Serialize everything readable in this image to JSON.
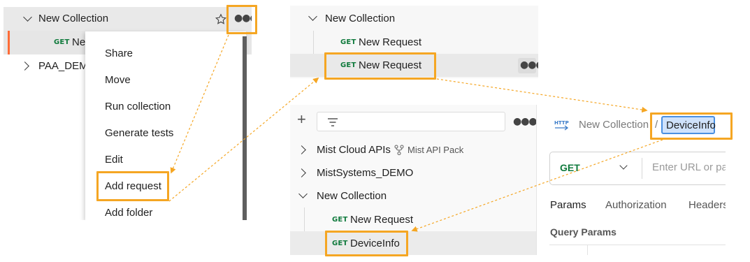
{
  "panelA": {
    "collection": "New Collection",
    "request_method": "GET",
    "request_name_truncated": "Ne",
    "second_collection": "PAA_DEM",
    "menu_items": [
      "Share",
      "Move",
      "Run collection",
      "Generate tests",
      "Edit",
      "Add request",
      "Add folder"
    ]
  },
  "panelB": {
    "collection": "New Collection",
    "requests": [
      {
        "method": "GET",
        "name": "New Request"
      },
      {
        "method": "GET",
        "name": "New Request"
      }
    ]
  },
  "panelC": {
    "collections": [
      {
        "name": "Mist Cloud APIs",
        "fork_label": "Mist API Pack"
      },
      {
        "name": "MistSystems_DEMO"
      },
      {
        "name": "New Collection"
      }
    ],
    "requests": [
      {
        "method": "GET",
        "name": "New Request"
      },
      {
        "method": "GET",
        "name": "DeviceInfo"
      }
    ]
  },
  "panelD": {
    "http_badge": "HTTP",
    "breadcrumb_collection": "New Collection",
    "breadcrumb_sep": "/",
    "request_title": "DeviceInfo",
    "method": "GET",
    "url_placeholder": "Enter URL or pa",
    "tabs": [
      "Params",
      "Authorization",
      "Headers"
    ],
    "section_title": "Query Params"
  },
  "colors": {
    "highlight": "#f5a623",
    "get_method": "#0f7a3c",
    "active_row": "#e9e9e9",
    "selection": "#ff6c37"
  }
}
